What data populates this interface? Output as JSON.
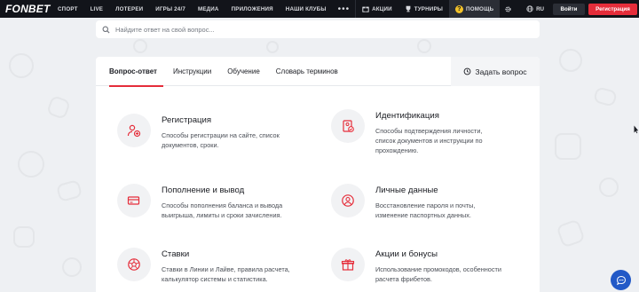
{
  "header": {
    "logo": "FONBET",
    "nav": [
      "СПОРТ",
      "LIVE",
      "ЛОТЕРЕИ",
      "ИГРЫ 24/7",
      "МЕДИА",
      "ПРИЛОЖЕНИЯ",
      "НАШИ КЛУБЫ"
    ],
    "more": "•••",
    "promo": "АКЦИИ",
    "tournaments": "ТУРНИРЫ",
    "help": "ПОМОЩЬ",
    "help_badge": "?",
    "lang": "RU",
    "login": "Войти",
    "register": "Регистрация"
  },
  "search": {
    "placeholder": "Найдите ответ на свой вопрос..."
  },
  "tabs": [
    "Вопрос-ответ",
    "Инструкции",
    "Обучение",
    "Словарь терминов"
  ],
  "ask_button": "Задать вопрос",
  "categories": [
    {
      "title": "Регистрация",
      "desc_1": "Способы регистрации на сайте, список",
      "desc_2": "документов, сроки.",
      "desc_3": "",
      "icon": "user-add-icon"
    },
    {
      "title": "Идентификация",
      "desc_1": "Способы подтверждения личности,",
      "desc_2": "список документов и инструкции по",
      "desc_3": "прохождению.",
      "icon": "id-document-icon"
    },
    {
      "title": "Пополнение и вывод",
      "desc_1": "Способы пополнения баланса и вывода",
      "desc_2": "выигрыша, лимиты и сроки зачисления.",
      "desc_3": "",
      "icon": "card-icon"
    },
    {
      "title": "Личные данные",
      "desc_1": "Восстановление пароля и почты,",
      "desc_2": "изменение паспортных данных.",
      "desc_3": "",
      "icon": "user-icon"
    },
    {
      "title": "Ставки",
      "desc_1": "Ставки в Линии и Лайве, правила расчета,",
      "desc_2": "калькулятор системы и статистика.",
      "desc_3": "",
      "icon": "ball-icon"
    },
    {
      "title": "Акции и бонусы",
      "desc_1": "Использование промокодов, особенности",
      "desc_2": "расчета фрибетов.",
      "desc_3": "",
      "icon": "gift-icon"
    }
  ],
  "colors": {
    "accent": "#e52d3a",
    "topbar": "#12141a",
    "background": "#eef0f3",
    "chat": "#2259c7",
    "help_badge": "#f3c22a"
  }
}
